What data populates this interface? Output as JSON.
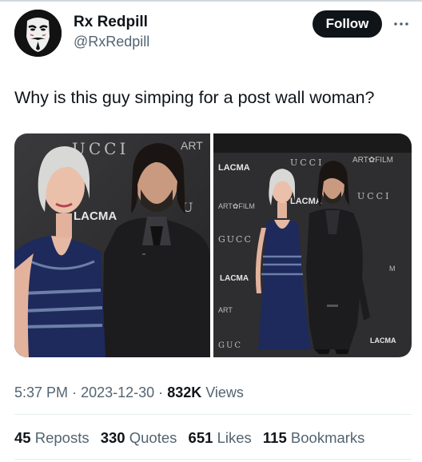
{
  "author": {
    "display_name": "Rx Redpill",
    "handle": "@RxRedpill"
  },
  "follow_label": "Follow",
  "tweet": {
    "text": "Why is this guy simping for a post wall woman?"
  },
  "media": {
    "left_backdrop": [
      "UCCI",
      "ART",
      "LACMA",
      "U"
    ],
    "right_backdrop": [
      "LACMA",
      "UCCI",
      "ART✿FILM",
      "ART✿FILM",
      "LACMA",
      "UCCI",
      "GUCC",
      "LACMA",
      "ART",
      "GUC",
      "LACMA",
      "M"
    ]
  },
  "meta": {
    "time": "5:37 PM",
    "separator": "·",
    "date": "2023-12-30",
    "views_count": "832K",
    "views_label": "Views"
  },
  "stats": [
    {
      "count": "45",
      "label": "Reposts"
    },
    {
      "count": "330",
      "label": "Quotes"
    },
    {
      "count": "651",
      "label": "Likes"
    },
    {
      "count": "115",
      "label": "Bookmarks"
    }
  ],
  "colors": {
    "text": "#0f1419",
    "secondary": "#536471",
    "follow_bg": "#0f1419",
    "dress": "#1e2a5c",
    "backdrop": "#2e2e30"
  }
}
